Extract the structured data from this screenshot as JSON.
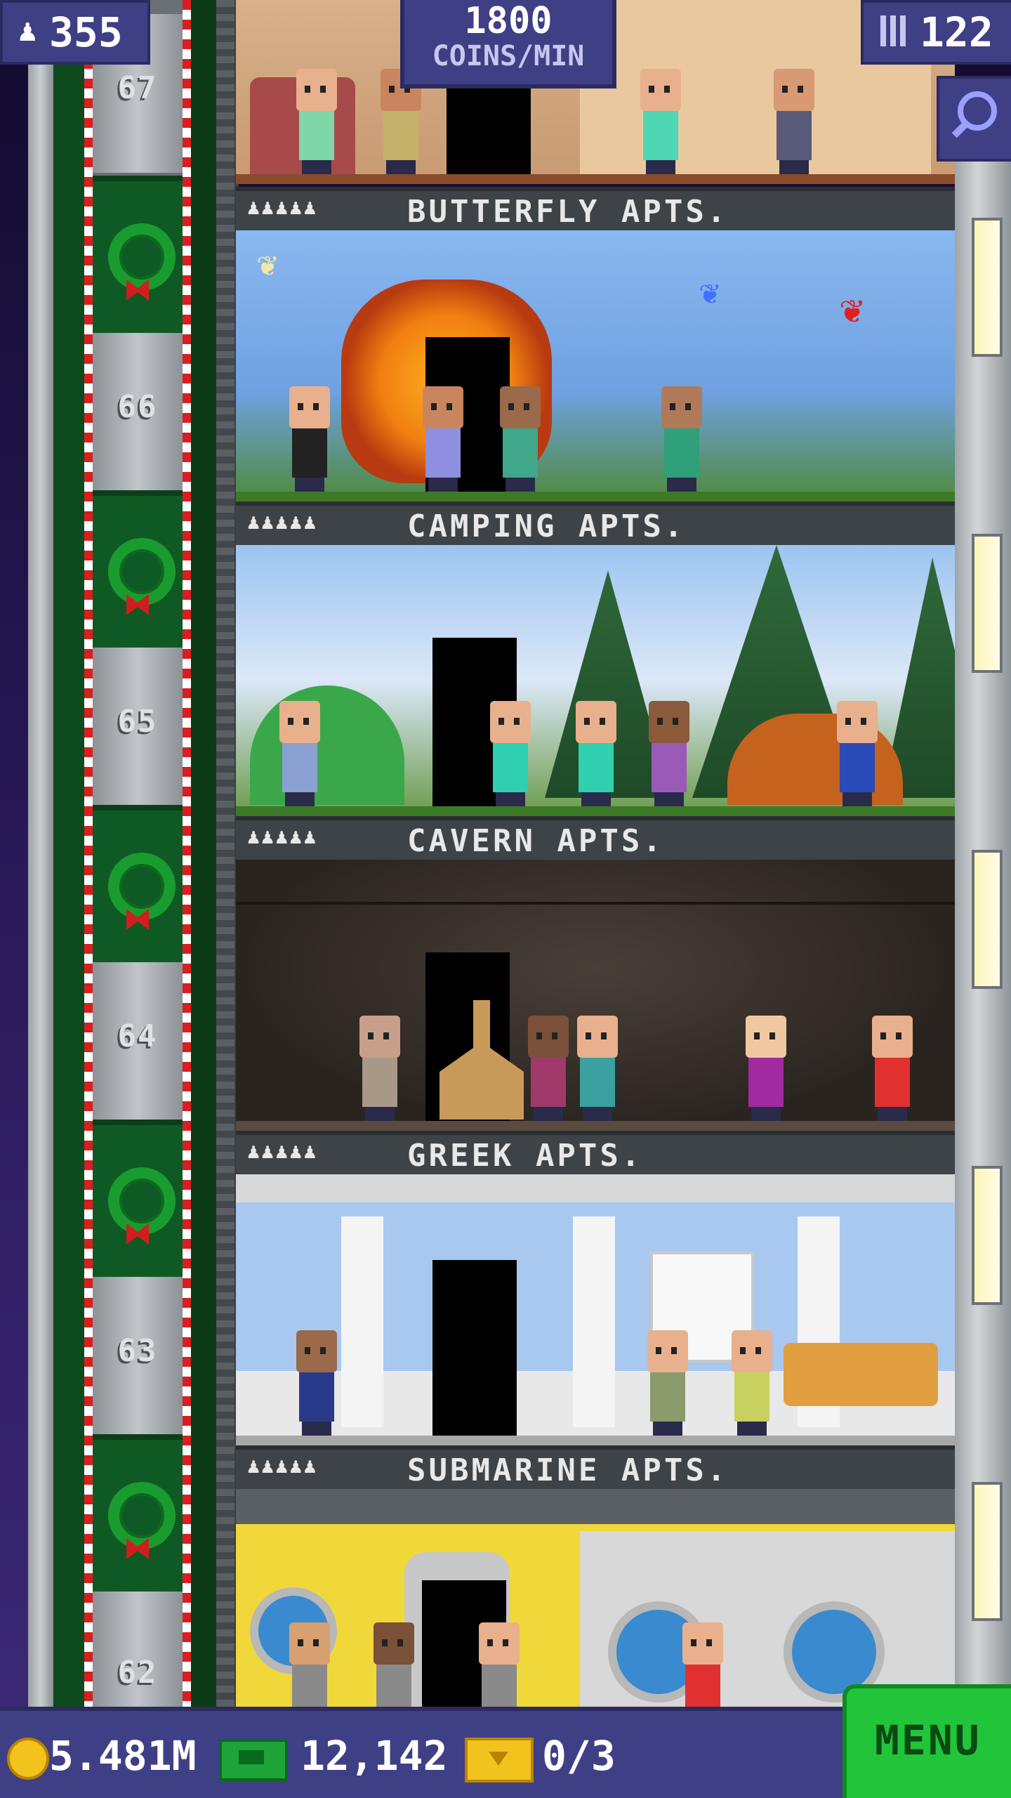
{
  "hud": {
    "population": "355",
    "coins_per_min_value": "1800",
    "coins_per_min_label": "COINS/MIN",
    "floor_count": "122"
  },
  "elevator": {
    "floor_numbers": [
      "67",
      "66",
      "65",
      "64",
      "63",
      "62"
    ]
  },
  "floors": [
    {
      "name": "BUTTERFLY APTS.",
      "people_indicator": "♟♟♟♟♟"
    },
    {
      "name": "CAMPING APTS.",
      "people_indicator": "♟♟♟♟♟"
    },
    {
      "name": "CAVERN APTS.",
      "people_indicator": "♟♟♟♟♟"
    },
    {
      "name": "GREEK APTS.",
      "people_indicator": "♟♟♟♟♟"
    },
    {
      "name": "SUBMARINE APTS.",
      "people_indicator": "♟♟♟♟♟"
    }
  ],
  "bottom_bar": {
    "coins": "5.481M",
    "bux": "12,142",
    "tickets": "0/3",
    "menu_label": "MENU"
  },
  "icons": {
    "population": "person-icon",
    "floors": "building-icon",
    "zoom": "magnifier-icon",
    "coins": "coin-icon",
    "bux": "cash-icon",
    "tickets": "ticket-icon"
  },
  "colors": {
    "hud_panel": "#3f3f86",
    "menu_green": "#22c43a",
    "candy_red": "#d81f1f"
  }
}
